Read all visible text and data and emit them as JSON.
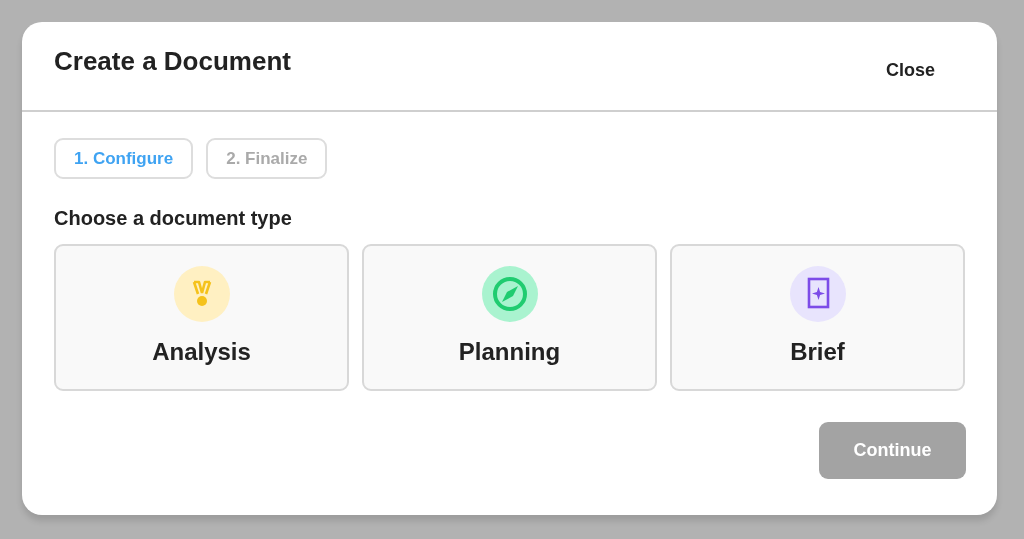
{
  "dialog": {
    "title": "Create a Document",
    "close_label": "Close"
  },
  "steps": [
    {
      "label": "1. Configure",
      "selected": true
    },
    {
      "label": "2. Finalize",
      "selected": false
    }
  ],
  "section_heading": "Choose a document type",
  "document_types": [
    {
      "label": "Analysis",
      "kind": "medal"
    },
    {
      "label": "Planning",
      "kind": "compass"
    },
    {
      "label": "Brief",
      "kind": "sparkle"
    }
  ],
  "continue_button": {
    "label": "Continue",
    "disabled": true
  }
}
